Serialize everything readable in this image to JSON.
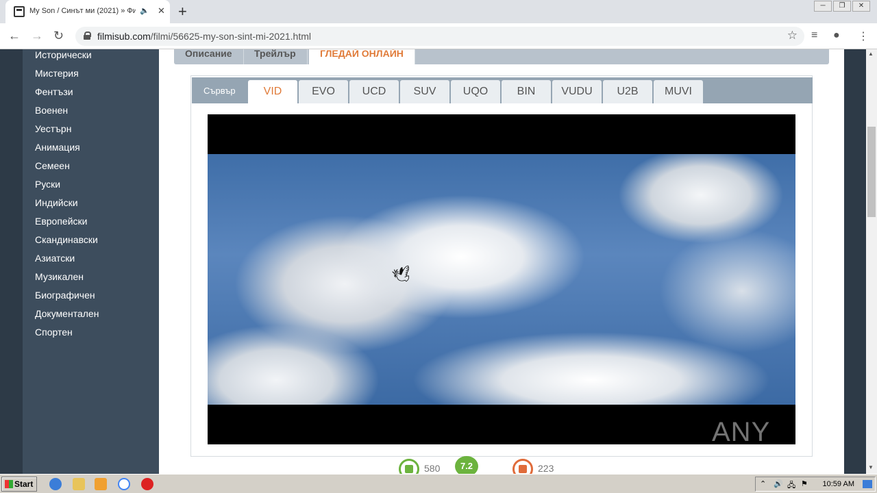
{
  "browser": {
    "tab_title": "My Son / Синът ми (2021) » Фи",
    "tab_audio_icon": "speaker-icon",
    "url_domain": "filmisub.com",
    "url_path": "/filmi/56625-my-son-sint-mi-2021.html"
  },
  "sidebar": {
    "items": [
      "Исторически",
      "Мистерия",
      "Фентъзи",
      "Военен",
      "Уестърн",
      "Анимация",
      "Семеен",
      "Руски",
      "Индийски",
      "Европейски",
      "Скандинавски",
      "Азиатски",
      "Музикален",
      "Биографичен",
      "Документален",
      "Спортен"
    ]
  },
  "info_tabs": [
    {
      "label": "Описание",
      "active": false
    },
    {
      "label": "Трейлър",
      "active": false
    },
    {
      "label": "ГЛЕДАЙ ОНЛАЙН",
      "active": true
    }
  ],
  "server": {
    "label": "Сървър",
    "tabs": [
      {
        "label": "VID",
        "active": true
      },
      {
        "label": "EVO",
        "active": false
      },
      {
        "label": "UCD",
        "active": false
      },
      {
        "label": "SUV",
        "active": false
      },
      {
        "label": "UQO",
        "active": false
      },
      {
        "label": "BIN",
        "active": false
      },
      {
        "label": "VUDU",
        "active": false
      },
      {
        "label": "U2B",
        "active": false
      },
      {
        "label": "MUVI",
        "active": false
      }
    ]
  },
  "watermark": "ANY RUN",
  "ratings": {
    "likes": "580",
    "score": "7.2",
    "dislikes": "223"
  },
  "taskbar": {
    "start_label": "Start",
    "clock": "10:59 AM"
  },
  "colors": {
    "accent": "#e07b39",
    "sidebar_bg": "#3d4d5d",
    "like": "#6cb33e",
    "dislike": "#e06b3a"
  }
}
